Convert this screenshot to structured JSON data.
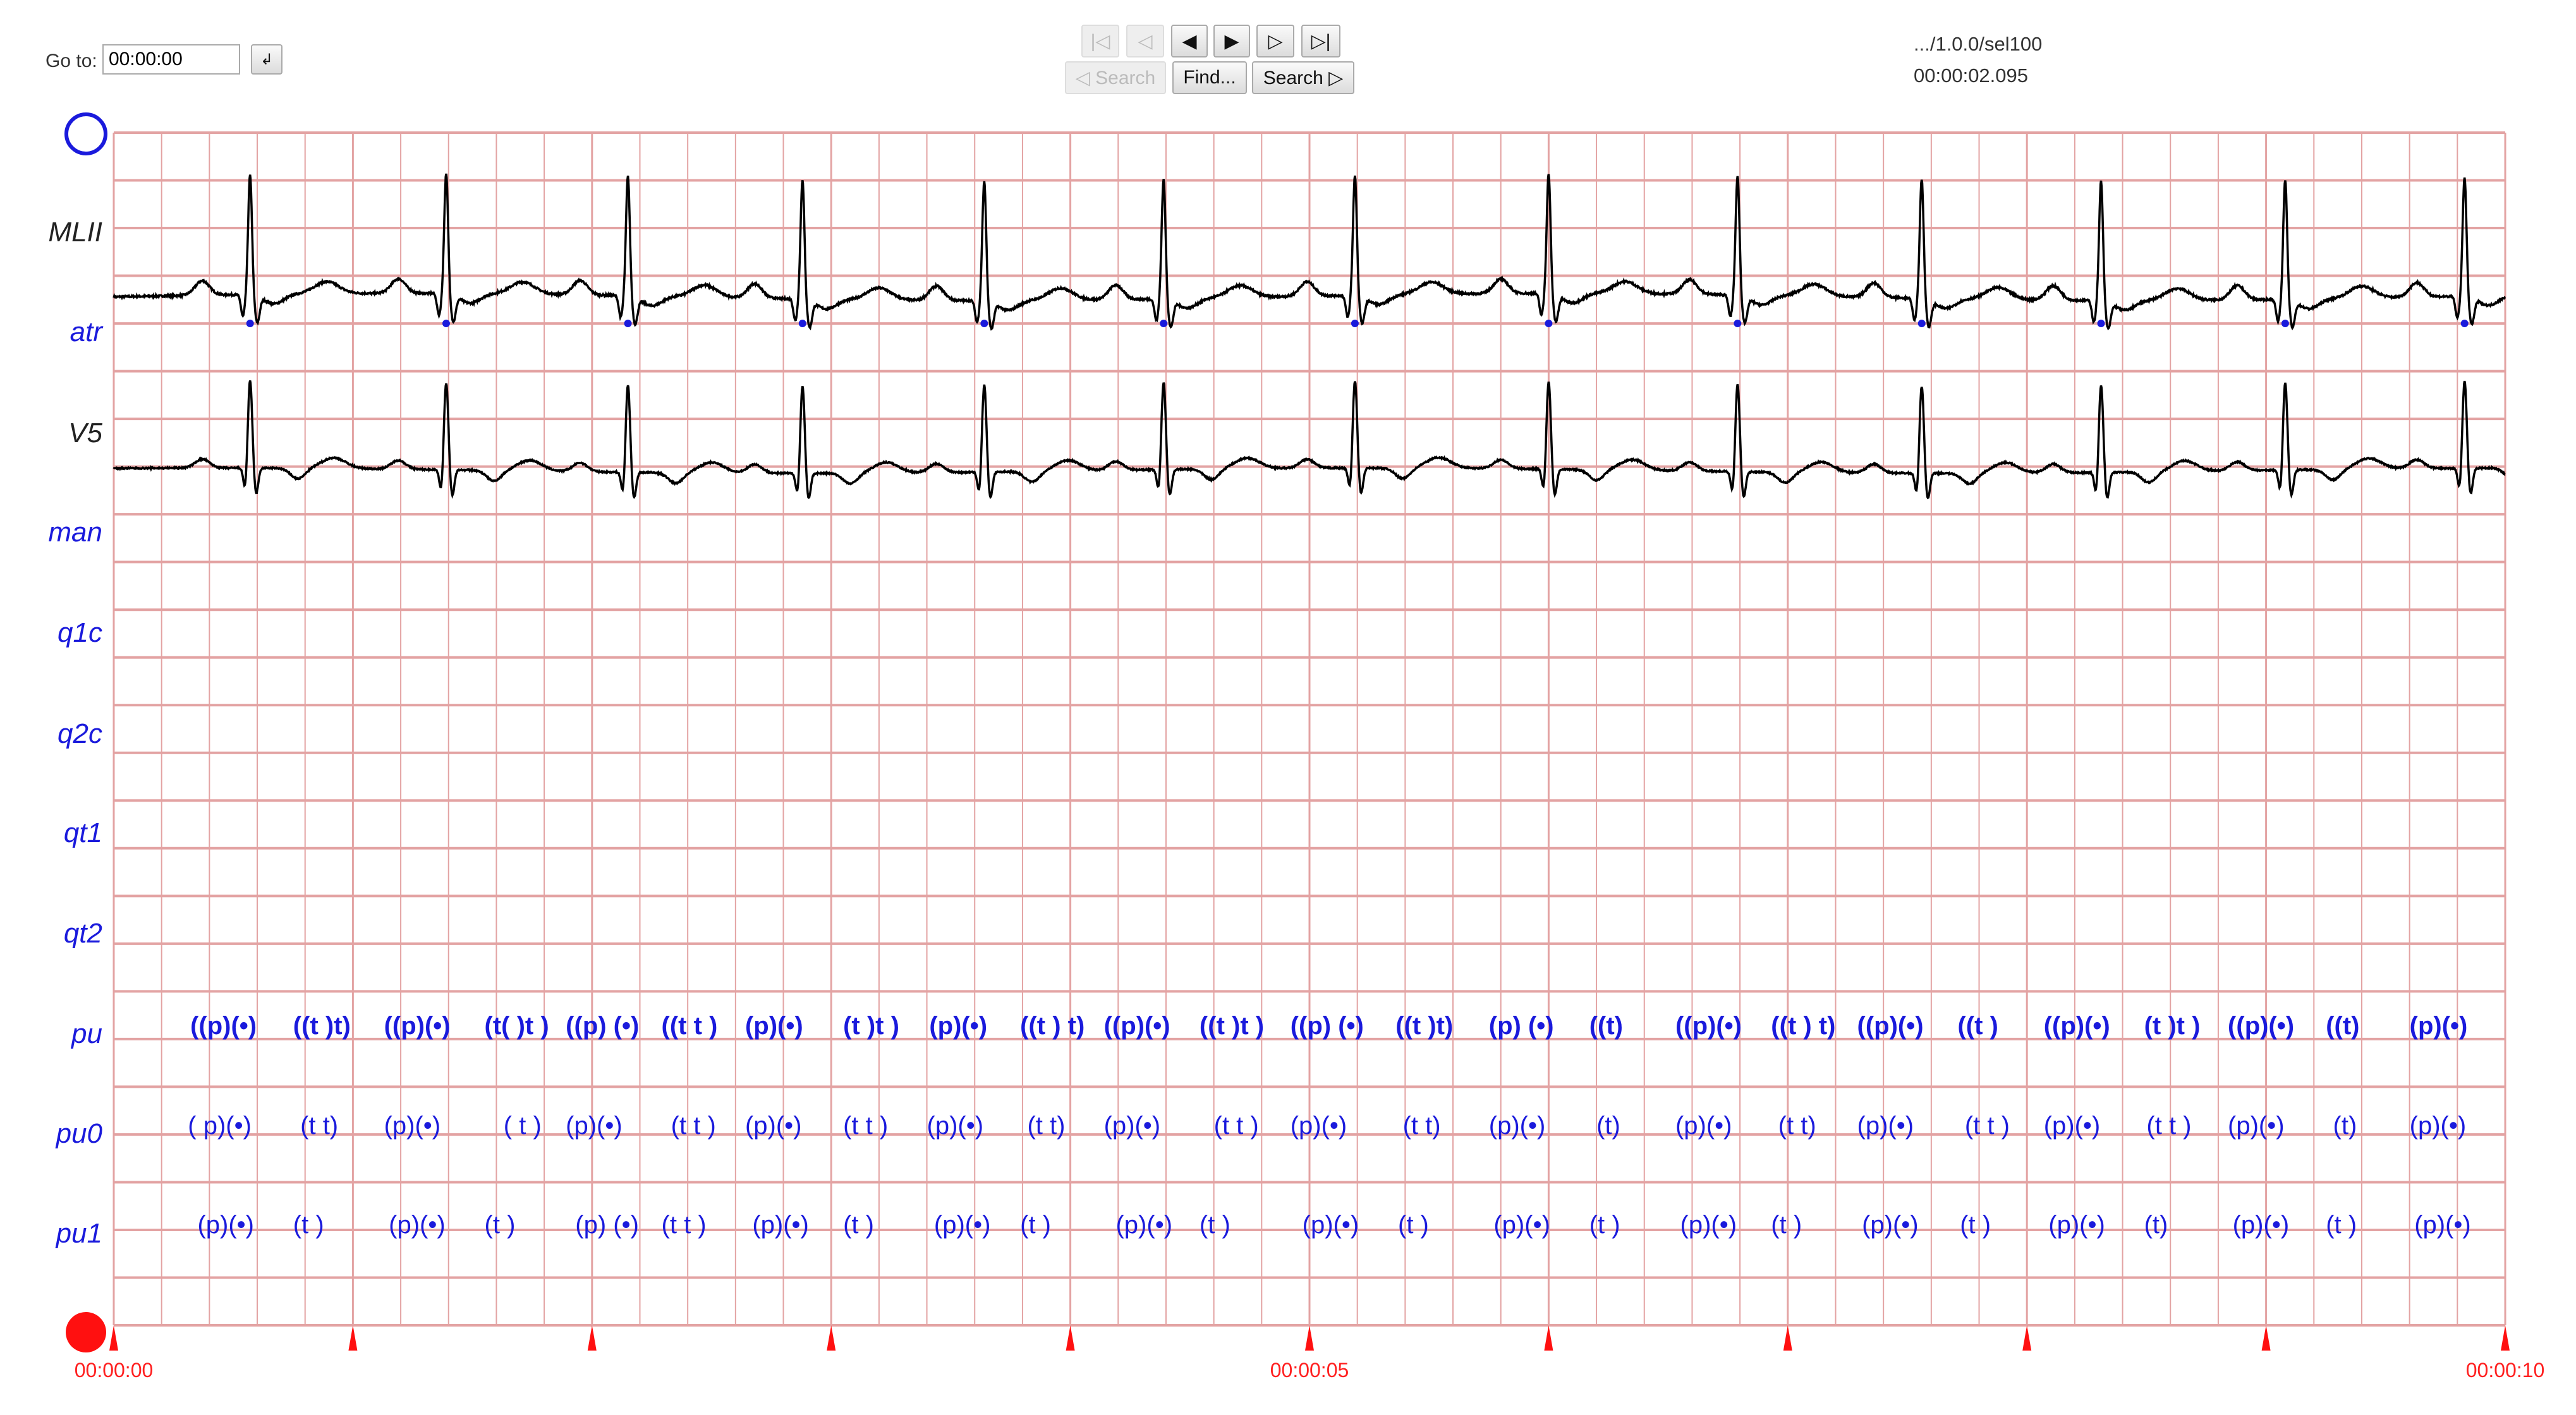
{
  "toolbar": {
    "goto_label": "Go to:",
    "goto_value": "00:00:00",
    "goto_button_icon": "return-arrow-icon",
    "nav_buttons": [
      {
        "icon": "first-icon",
        "glyph": "|◁",
        "enabled": false
      },
      {
        "icon": "prev-icon",
        "glyph": "◁",
        "enabled": false
      },
      {
        "icon": "back-icon",
        "glyph": "◀",
        "enabled": true
      },
      {
        "icon": "forward-icon",
        "glyph": "▶",
        "enabled": true
      },
      {
        "icon": "next-icon",
        "glyph": "▷",
        "enabled": true
      },
      {
        "icon": "last-icon",
        "glyph": "▷|",
        "enabled": true
      }
    ],
    "search_back_label": "◁ Search",
    "find_label": "Find...",
    "search_fwd_label": "Search ▷"
  },
  "record": {
    "path": ".../1.0.0/sel100",
    "time": "00:00:02.095"
  },
  "colors": {
    "grid": "#e3a3a3",
    "signal": "#000000",
    "annotation": "#1a1adc",
    "time_axis": "#ff2020"
  },
  "channels": [
    {
      "name": "MLII",
      "kind": "signal"
    },
    {
      "name": "atr",
      "kind": "annotator"
    },
    {
      "name": "V5",
      "kind": "signal"
    },
    {
      "name": "man",
      "kind": "annotator"
    },
    {
      "name": "q1c",
      "kind": "annotator"
    },
    {
      "name": "q2c",
      "kind": "annotator"
    },
    {
      "name": "qt1",
      "kind": "annotator"
    },
    {
      "name": "qt2",
      "kind": "annotator"
    },
    {
      "name": "pu",
      "kind": "annotator"
    },
    {
      "name": "pu0",
      "kind": "annotator"
    },
    {
      "name": "pu1",
      "kind": "annotator"
    }
  ],
  "time_axis": {
    "start": "00:00:00",
    "mid": "00:00:05",
    "end": "00:00:10",
    "duration_s": 10
  },
  "atr_beats_s": [
    0.57,
    1.39,
    2.15,
    2.88,
    3.64,
    4.39,
    5.19,
    6.0,
    6.79,
    7.56,
    8.31,
    9.08,
    9.83
  ],
  "annotations": {
    "pu": [
      {
        "t": 0.32,
        "text": "((p)(•)"
      },
      {
        "t": 0.75,
        "text": "((t )t)"
      },
      {
        "t": 1.13,
        "text": "((p)(•)"
      },
      {
        "t": 1.55,
        "text": "(t( )t )"
      },
      {
        "t": 1.89,
        "text": "((p) (•)"
      },
      {
        "t": 2.29,
        "text": "((t t )"
      },
      {
        "t": 2.64,
        "text": "(p)(•)"
      },
      {
        "t": 3.05,
        "text": "(t )t )"
      },
      {
        "t": 3.41,
        "text": "(p)(•)"
      },
      {
        "t": 3.79,
        "text": "((t ) t)"
      },
      {
        "t": 4.14,
        "text": "((p)(•)"
      },
      {
        "t": 4.54,
        "text": "((t )t )"
      },
      {
        "t": 4.92,
        "text": "((p) (•)"
      },
      {
        "t": 5.36,
        "text": "((t )t)"
      },
      {
        "t": 5.75,
        "text": "(p) (•)"
      },
      {
        "t": 6.17,
        "text": "((t)"
      },
      {
        "t": 6.53,
        "text": "((p)(•)"
      },
      {
        "t": 6.93,
        "text": "((t ) t)"
      },
      {
        "t": 7.29,
        "text": "((p)(•)"
      },
      {
        "t": 7.71,
        "text": "((t )"
      },
      {
        "t": 8.07,
        "text": "((p)(•)"
      },
      {
        "t": 8.49,
        "text": "(t )t )"
      },
      {
        "t": 8.84,
        "text": "((p)(•)"
      },
      {
        "t": 9.25,
        "text": "((t)"
      },
      {
        "t": 9.6,
        "text": "(p)(•)"
      }
    ],
    "pu0": [
      {
        "t": 0.31,
        "text": "( p)(•)"
      },
      {
        "t": 0.78,
        "text": "(t t)"
      },
      {
        "t": 1.13,
        "text": "(p)(•)"
      },
      {
        "t": 1.63,
        "text": "( t )"
      },
      {
        "t": 1.89,
        "text": "(p)(•)"
      },
      {
        "t": 2.33,
        "text": "(t t )"
      },
      {
        "t": 2.64,
        "text": "(p)(•)"
      },
      {
        "t": 3.05,
        "text": "(t t )"
      },
      {
        "t": 3.4,
        "text": "(p)(•)"
      },
      {
        "t": 3.82,
        "text": "(t  t)"
      },
      {
        "t": 4.14,
        "text": "(p)(•)"
      },
      {
        "t": 4.6,
        "text": "(t t )"
      },
      {
        "t": 4.92,
        "text": "(p)(•)"
      },
      {
        "t": 5.39,
        "text": "(t t)"
      },
      {
        "t": 5.75,
        "text": "(p)(•)"
      },
      {
        "t": 6.2,
        "text": "(t)"
      },
      {
        "t": 6.53,
        "text": "(p)(•)"
      },
      {
        "t": 6.96,
        "text": "(t  t)"
      },
      {
        "t": 7.29,
        "text": "(p)(•)"
      },
      {
        "t": 7.74,
        "text": "(t t )"
      },
      {
        "t": 8.07,
        "text": "(p)(•)"
      },
      {
        "t": 8.5,
        "text": "(t t )"
      },
      {
        "t": 8.84,
        "text": "(p)(•)"
      },
      {
        "t": 9.28,
        "text": "(t)"
      },
      {
        "t": 9.6,
        "text": "(p)(•)"
      }
    ],
    "pu1": [
      {
        "t": 0.35,
        "text": "(p)(•)"
      },
      {
        "t": 0.75,
        "text": "(t )"
      },
      {
        "t": 1.15,
        "text": "(p)(•)"
      },
      {
        "t": 1.55,
        "text": "(t )"
      },
      {
        "t": 1.93,
        "text": "(p) (•)"
      },
      {
        "t": 2.29,
        "text": "(t t )"
      },
      {
        "t": 2.67,
        "text": "(p)(•)"
      },
      {
        "t": 3.05,
        "text": "(t )"
      },
      {
        "t": 3.43,
        "text": "(p)(•)"
      },
      {
        "t": 3.79,
        "text": "(t )"
      },
      {
        "t": 4.19,
        "text": "(p)(•)"
      },
      {
        "t": 4.54,
        "text": "(t )"
      },
      {
        "t": 4.97,
        "text": "(p)(•)"
      },
      {
        "t": 5.37,
        "text": "(t )"
      },
      {
        "t": 5.77,
        "text": "(p)(•)"
      },
      {
        "t": 6.17,
        "text": "(t )"
      },
      {
        "t": 6.55,
        "text": "(p)(•)"
      },
      {
        "t": 6.93,
        "text": "(t )"
      },
      {
        "t": 7.31,
        "text": "(p)(•)"
      },
      {
        "t": 7.72,
        "text": "(t )"
      },
      {
        "t": 8.09,
        "text": "(p)(•)"
      },
      {
        "t": 8.49,
        "text": "(t)"
      },
      {
        "t": 8.86,
        "text": "(p)(•)"
      },
      {
        "t": 9.25,
        "text": "(t )"
      },
      {
        "t": 9.62,
        "text": "(p)(•)"
      }
    ]
  }
}
